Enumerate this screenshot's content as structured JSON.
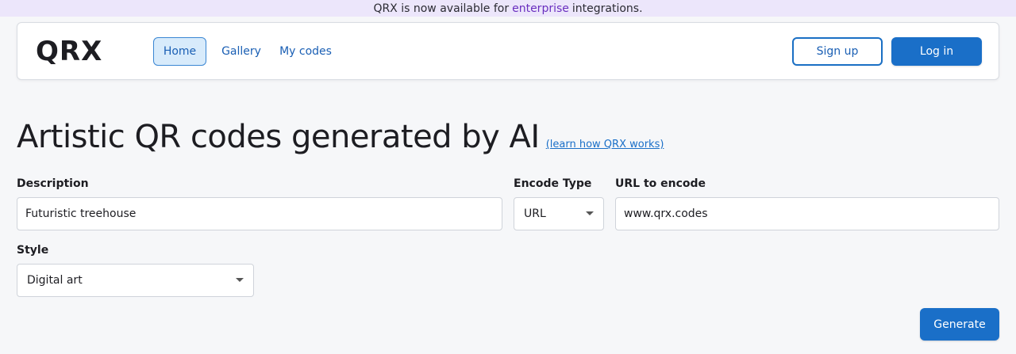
{
  "banner": {
    "prefix": "QRX is now available for",
    "highlight": "enterprise",
    "suffix": "integrations."
  },
  "nav": {
    "logo": "QRX",
    "links": [
      {
        "label": "Home",
        "active": true
      },
      {
        "label": "Gallery",
        "active": false
      },
      {
        "label": "My codes",
        "active": false
      }
    ],
    "signup_label": "Sign up",
    "login_label": "Log in"
  },
  "hero": {
    "title": "Artistic QR codes generated by AI",
    "learn_link": "(learn how QRX works)"
  },
  "form": {
    "description": {
      "label": "Description",
      "value": "Futuristic treehouse"
    },
    "encode_type": {
      "label": "Encode Type",
      "value": "URL"
    },
    "url": {
      "label": "URL to encode",
      "value": "www.qrx.codes"
    },
    "style": {
      "label": "Style",
      "value": "Digital art"
    },
    "generate_label": "Generate"
  },
  "colors": {
    "banner_bg": "#ece6fb",
    "highlight": "#6a2fbf",
    "accent": "#1a6fc8",
    "active_tab_bg": "#d8ebfb",
    "page_bg": "#f6f7f9"
  },
  "icons": {
    "select_caret": "chevron-down-icon"
  }
}
